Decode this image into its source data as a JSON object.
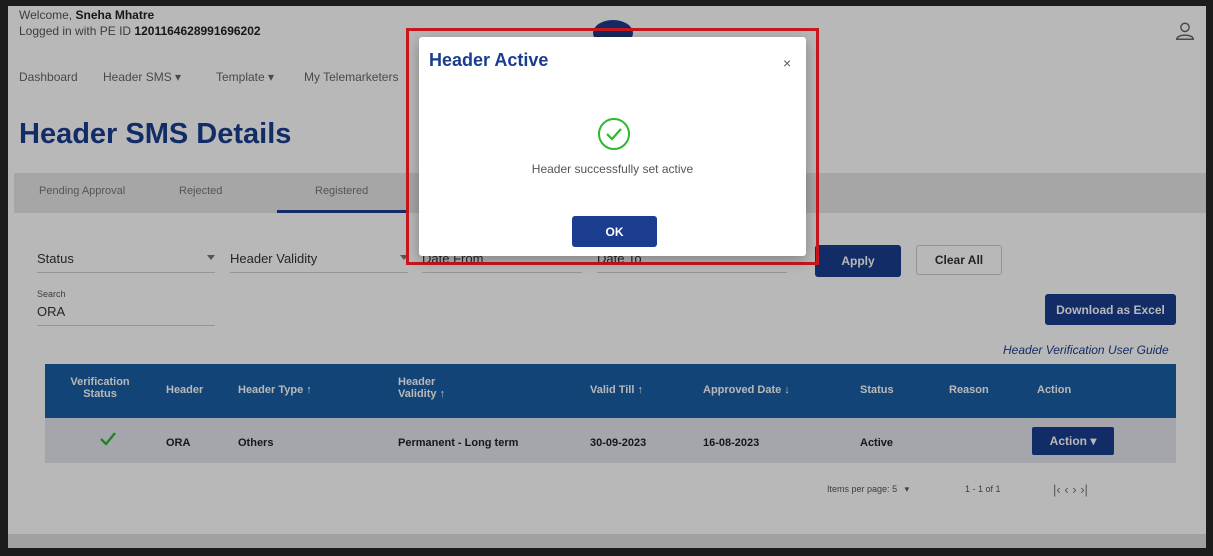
{
  "header": {
    "welcome_prefix": "Welcome,",
    "user_name": "Sneha Mhatre",
    "pe_prefix": "Logged in with PE ID",
    "pe_id": "1201164628991696202"
  },
  "nav": {
    "items": [
      "Dashboard",
      "Header SMS ▾",
      "Template ▾",
      "My Telemarketers"
    ]
  },
  "page": {
    "title": "Header SMS Details"
  },
  "tabs": [
    "Pending Approval",
    "Rejected",
    "Registered"
  ],
  "filters": {
    "status_label": "Status",
    "validity_label": "Header Validity",
    "date_from": "Date From",
    "date_to": "Date To",
    "apply": "Apply",
    "clear": "Clear All",
    "search_label": "Search",
    "search_value": "ORA",
    "download": "Download as Excel",
    "guide": "Header Verification User Guide"
  },
  "table": {
    "columns": [
      "Verification Status",
      "Header",
      "Header Type ↑",
      "Header Validity ↑",
      "Valid Till ↑",
      "Approved Date ↓",
      "Status",
      "Reason",
      "Action"
    ],
    "row": {
      "header": "ORA",
      "type": "Others",
      "validity": "Permanent - Long term",
      "valid_till": "30-09-2023",
      "approved": "16-08-2023",
      "status": "Active",
      "action": "Action ▾"
    }
  },
  "pagination": {
    "items_per_page_label": "Items per page:",
    "items_per_page": "5",
    "range": "1 - 1 of 1",
    "nav": "|‹   ‹   ›   ›|"
  },
  "modal": {
    "title": "Header Active",
    "close": "×",
    "message": "Header successfully set active",
    "ok": "OK"
  },
  "colors": {
    "primary": "#1a3d8f",
    "table_header": "#1a5fa5",
    "success": "#2eb82e",
    "highlight_outline": "#c8171e"
  }
}
